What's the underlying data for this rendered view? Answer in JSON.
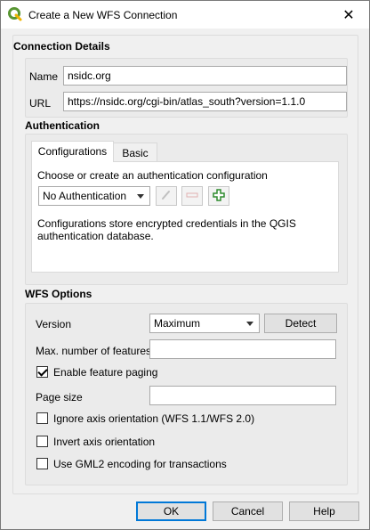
{
  "window": {
    "title": "Create a New WFS Connection",
    "close_glyph": "✕"
  },
  "connection": {
    "section_title": "Connection Details",
    "name_label": "Name",
    "name_value": "nsidc.org",
    "url_label": "URL",
    "url_value": "https://nsidc.org/cgi-bin/atlas_south?version=1.1.0"
  },
  "auth": {
    "section_title": "Authentication",
    "tabs": [
      "Configurations",
      "Basic"
    ],
    "prompt": "Choose or create an authentication configuration",
    "selected_config": "No Authentication",
    "info_line1": "Configurations store encrypted credentials in the QGIS",
    "info_line2": "authentication database."
  },
  "wfs": {
    "section_title": "WFS Options",
    "version_label": "Version",
    "version_value": "Maximum",
    "detect_label": "Detect",
    "max_features_label": "Max. number of features",
    "max_features_value": "",
    "paging_label": "Enable feature paging",
    "paging_checked": true,
    "page_size_label": "Page size",
    "page_size_value": "",
    "ignore_axis_label": "Ignore axis orientation (WFS 1.1/WFS 2.0)",
    "ignore_axis_checked": false,
    "invert_axis_label": "Invert axis orientation",
    "invert_axis_checked": false,
    "gml2_label": "Use GML2 encoding for transactions",
    "gml2_checked": false
  },
  "buttons": {
    "ok": "OK",
    "cancel": "Cancel",
    "help": "Help"
  },
  "colors": {
    "accent": "#0078d7",
    "qgis_green": "#589632",
    "add_green": "#2e8b2e"
  }
}
